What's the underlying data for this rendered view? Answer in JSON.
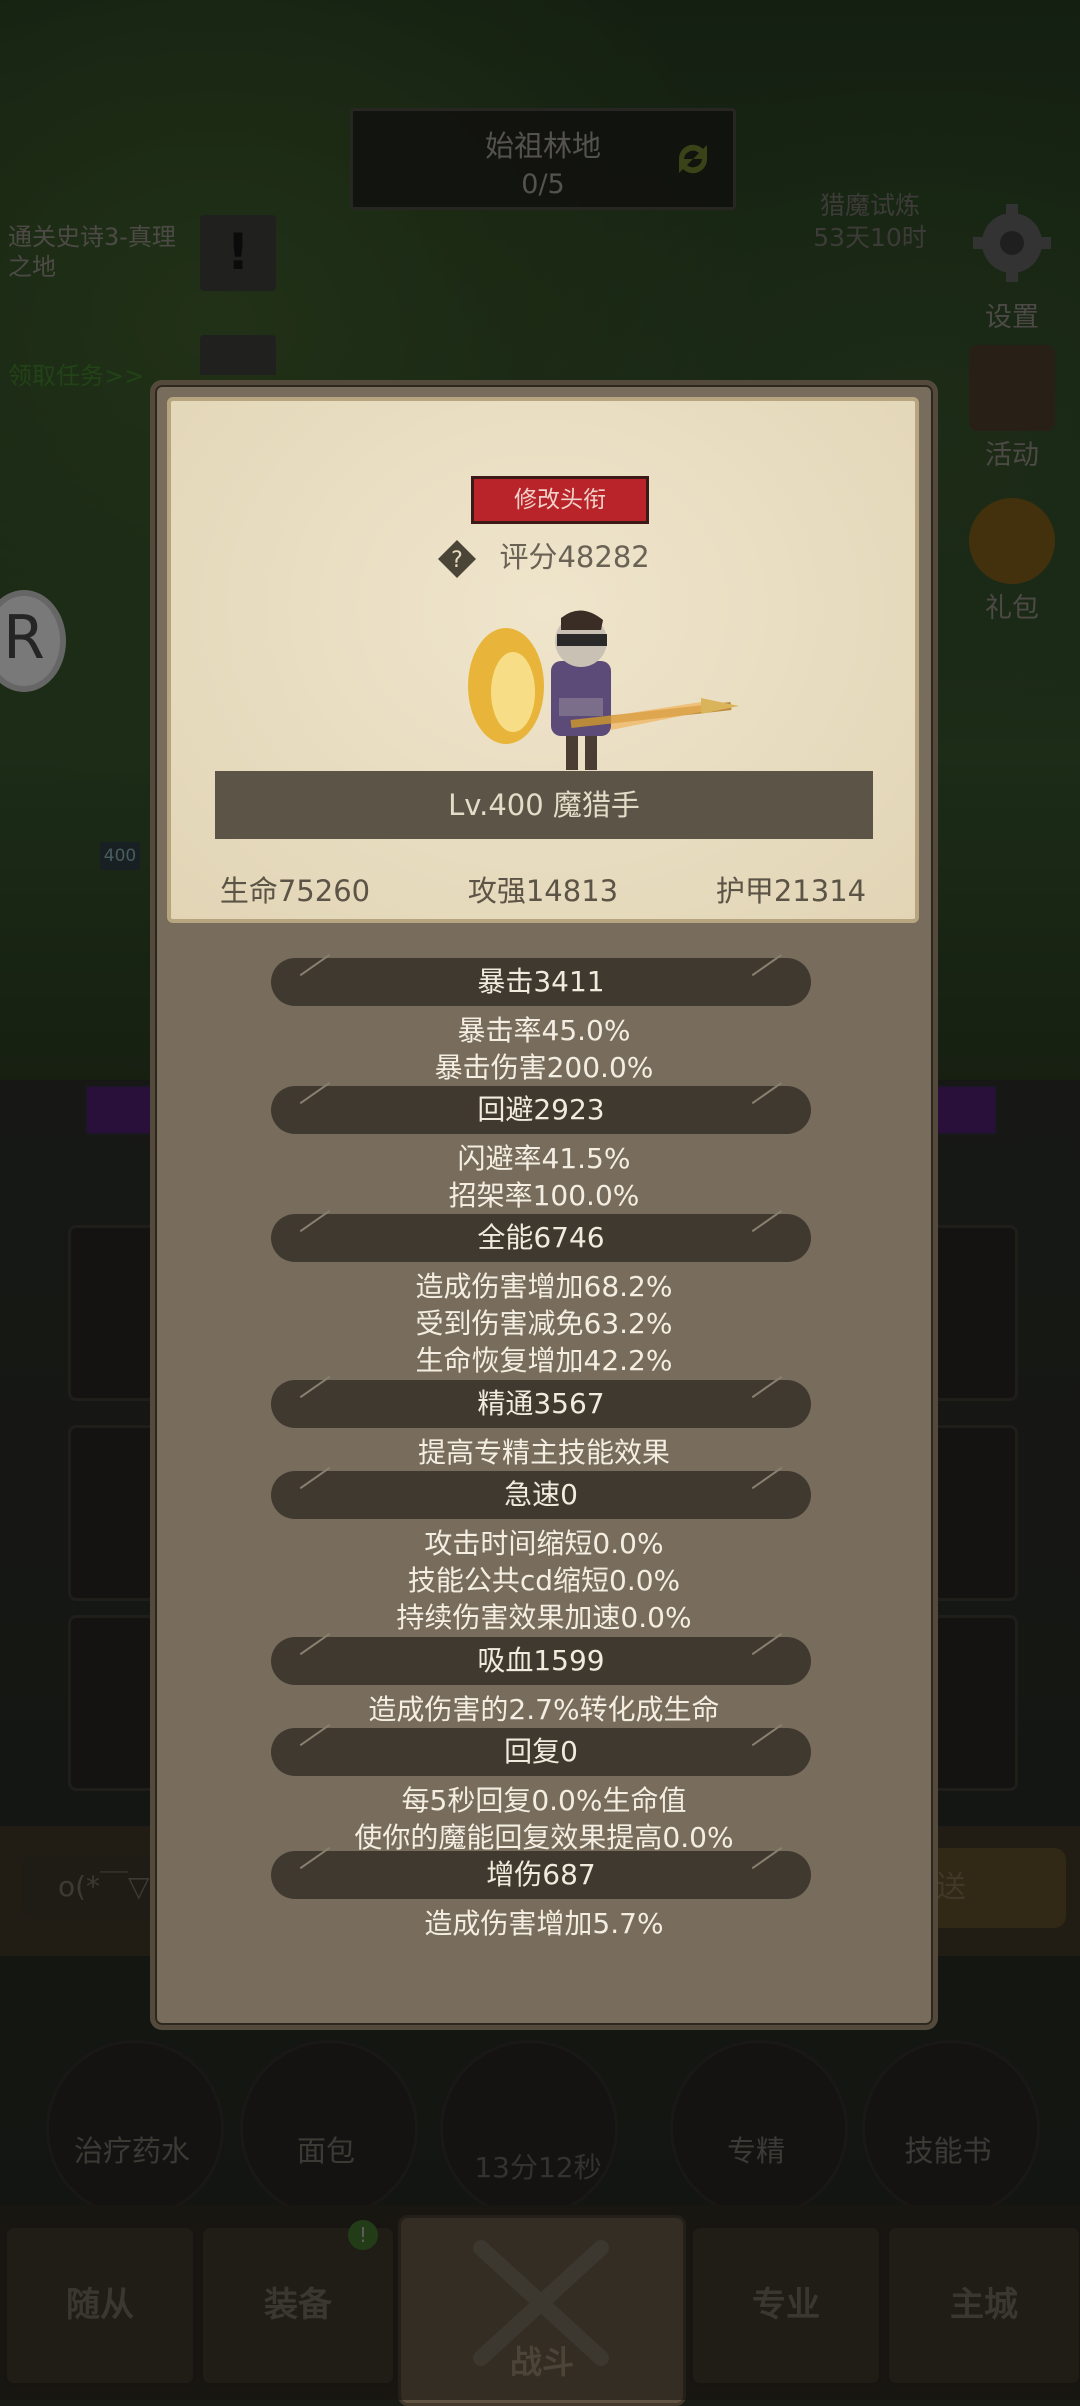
{
  "background": {
    "zone_name": "始祖林地",
    "zone_progress": "0/5",
    "quest_text": "通关史诗3-真理之地",
    "quest_badge": "!",
    "quest_link": "领取任务>>",
    "hunt_label": "猎魔试炼",
    "hunt_timer": "53天10时",
    "settings_label": "设置",
    "activity_label": "活动",
    "gift_label": "礼包",
    "level_tag": "400",
    "chat_placeholder": "o(*￣▽",
    "send_label": "发送",
    "items": [
      "治疗药水",
      "面包",
      "专精",
      "技能书"
    ],
    "chest_timer": "13分12秒",
    "nav": {
      "follower": "随从",
      "equipment": "装备",
      "battle": "战斗",
      "profession": "专业",
      "main_city": "主城"
    },
    "nav_badge": "!"
  },
  "popup": {
    "change_title_button": "修改头衔",
    "help_icon_glyph": "?",
    "score": "评分48282",
    "level_name": "Lv.400 魔猎手",
    "hp": "生命75260",
    "attack": "攻强14813",
    "armor": "护甲21314",
    "sections": [
      {
        "header": "暴击3411",
        "lines": [
          "暴击率45.0%",
          "暴击伤害200.0%"
        ]
      },
      {
        "header": "回避2923",
        "lines": [
          "闪避率41.5%",
          "招架率100.0%"
        ]
      },
      {
        "header": "全能6746",
        "lines": [
          "造成伤害增加68.2%",
          "受到伤害减免63.2%",
          "生命恢复增加42.2%"
        ]
      },
      {
        "header": "精通3567",
        "lines": [
          "提高专精主技能效果"
        ]
      },
      {
        "header": "急速0",
        "lines": [
          "攻击时间缩短0.0%",
          "技能公共cd缩短0.0%",
          "持续伤害效果加速0.0%"
        ]
      },
      {
        "header": "吸血1599",
        "lines": [
          "造成伤害的2.7%转化成生命"
        ]
      },
      {
        "header": "回复0",
        "lines": [
          "每5秒回复0.0%生命值",
          "使你的魔能回复效果提高0.0%"
        ]
      },
      {
        "header": "增伤687",
        "lines": [
          "造成伤害增加5.7%"
        ]
      }
    ]
  }
}
